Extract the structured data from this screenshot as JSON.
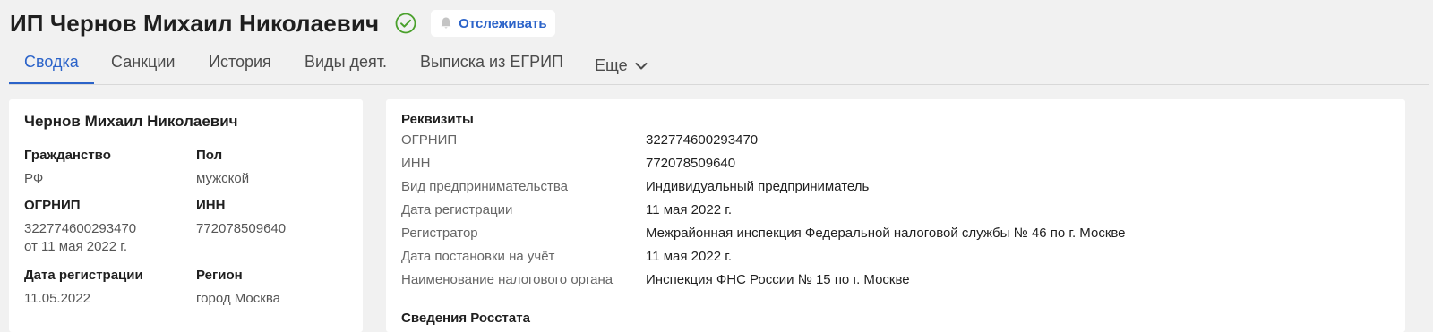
{
  "header": {
    "title": "ИП Чернов Михаил Николаевич",
    "verified_icon": "check-circle-icon",
    "follow_label": "Отслеживать",
    "follow_icon": "bell-icon"
  },
  "colors": {
    "accent": "#2b63c9",
    "verified": "#4aa02c",
    "background": "#f1f1f1",
    "card": "#ffffff"
  },
  "tabs": [
    {
      "label": "Сводка",
      "active": true
    },
    {
      "label": "Санкции",
      "active": false
    },
    {
      "label": "История",
      "active": false
    },
    {
      "label": "Виды деят.",
      "active": false
    },
    {
      "label": "Выписка из ЕГРИП",
      "active": false
    },
    {
      "label": "Еще",
      "active": false,
      "icon": "chevron-down-icon"
    }
  ],
  "person_card": {
    "name": "Чернов Михаил Николаевич",
    "fields": {
      "citizenship": {
        "label": "Гражданство",
        "value": "РФ"
      },
      "gender": {
        "label": "Пол",
        "value": "мужской"
      },
      "ogrnip": {
        "label": "ОГРНИП",
        "value": "322774600293470",
        "sub": "от 11 мая 2022 г."
      },
      "inn": {
        "label": "ИНН",
        "value": "772078509640"
      },
      "reg_date": {
        "label": "Дата регистрации",
        "value": "11.05.2022"
      },
      "region": {
        "label": "Регион",
        "value": "город Москва"
      }
    }
  },
  "requisites": {
    "title": "Реквизиты",
    "rows": [
      {
        "key": "ОГРНИП",
        "value": "322774600293470"
      },
      {
        "key": "ИНН",
        "value": "772078509640"
      },
      {
        "key": "Вид предпринимательства",
        "value": "Индивидуальный предприниматель"
      },
      {
        "key": "Дата регистрации",
        "value": "11 мая 2022 г."
      },
      {
        "key": "Регистратор",
        "value": "Межрайонная инспекция Федеральной налоговой службы № 46 по г. Москве"
      },
      {
        "key": "Дата постановки на учёт",
        "value": "11 мая 2022 г."
      },
      {
        "key": "Наименование налогового органа",
        "value": "Инспекция ФНС России № 15 по г. Москве"
      }
    ],
    "next_section_title": "Сведения Росстата"
  }
}
